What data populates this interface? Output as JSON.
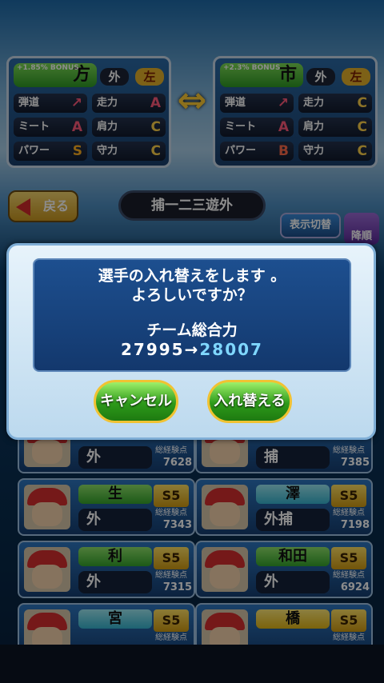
{
  "compare": {
    "left": {
      "bonus": "+1.85%\nBONUS",
      "name": "方",
      "position": "外",
      "throw_icon": "左",
      "stats": [
        {
          "label": "弾道",
          "grade": "↗"
        },
        {
          "label": "走力",
          "grade": "A"
        },
        {
          "label": "ミート",
          "grade": "A"
        },
        {
          "label": "肩力",
          "grade": "C"
        },
        {
          "label": "パワー",
          "grade": "S"
        },
        {
          "label": "守力",
          "grade": "C"
        }
      ]
    },
    "right": {
      "bonus": "+2.3%\nBONUS",
      "name": "市",
      "position": "外",
      "throw_icon": "左",
      "stats": [
        {
          "label": "弾道",
          "grade": "↗"
        },
        {
          "label": "走力",
          "grade": "C"
        },
        {
          "label": "ミート",
          "grade": "A"
        },
        {
          "label": "肩力",
          "grade": "C"
        },
        {
          "label": "パワー",
          "grade": "B"
        },
        {
          "label": "守力",
          "grade": "C"
        }
      ]
    },
    "swap_symbol": "⇔"
  },
  "toolbar": {
    "back_label": "戻る",
    "filter_label": "捕一二三遊外",
    "view_toggle_label": "表示切替",
    "order_label": "降順"
  },
  "players": [
    {
      "name": "",
      "name_color": "green",
      "position": "外",
      "points_label": "総経験点",
      "points": "7628"
    },
    {
      "name": "",
      "name_color": "cyan",
      "position": "捕",
      "points_label": "総経験点",
      "points": "7385"
    },
    {
      "name": "生",
      "name_color": "green",
      "position": "外",
      "points_label": "総経験点",
      "points": "7343",
      "rank": "S5"
    },
    {
      "name": "澤",
      "name_color": "cyan",
      "position": "外捕",
      "points_label": "総経験点",
      "points": "7198",
      "rank": "S5"
    },
    {
      "name": "利",
      "name_color": "green",
      "position": "外",
      "points_label": "総経験点",
      "points": "7315",
      "rank": "S5"
    },
    {
      "name": "和田",
      "name_color": "green",
      "position": "外",
      "points_label": "総経験点",
      "points": "6924",
      "rank": "S5"
    },
    {
      "name": "宮",
      "name_color": "cyan",
      "position": "",
      "points_label": "総経験点",
      "points": "",
      "rank": "S5"
    },
    {
      "name": "橋",
      "name_color": "yellow",
      "position": "",
      "points_label": "総経験点",
      "points": "",
      "rank": "S5"
    }
  ],
  "dialog": {
    "line1": "選手の入れ替えをします 。",
    "line2": "よろしいですか？",
    "power_label": "チーム総合力",
    "power_old": "27995",
    "arrow": "→",
    "power_new": "28007",
    "cancel_label": "キャンセル",
    "confirm_label": "入れ替える"
  }
}
